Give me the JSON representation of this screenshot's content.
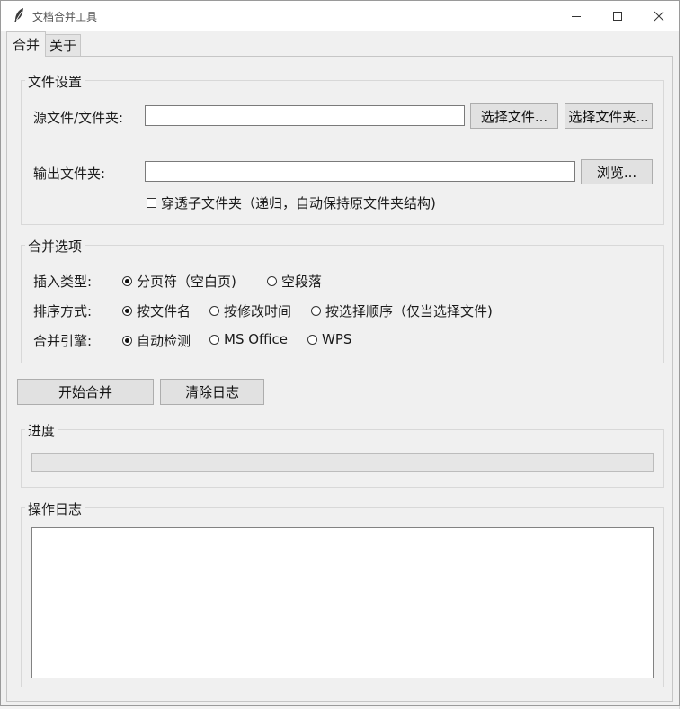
{
  "window": {
    "title": "文档合并工具",
    "controls": {
      "minimize": "minimize-icon",
      "maximize": "maximize-icon",
      "close": "close-icon"
    }
  },
  "tabs": [
    {
      "label": "合并",
      "active": true
    },
    {
      "label": "关于",
      "active": false
    }
  ],
  "file_settings": {
    "title": "文件设置",
    "source_label": "源文件/文件夹:",
    "source_value": "",
    "select_file_button": "选择文件...",
    "select_folder_button": "选择文件夹...",
    "output_label": "输出文件夹:",
    "output_value": "",
    "browse_button": "浏览...",
    "recursive_checkbox": "穿透子文件夹（递归，自动保持原文件夹结构)",
    "recursive_checked": false
  },
  "merge_options": {
    "title": "合并选项",
    "insert_type": {
      "label": "插入类型:",
      "options": [
        "分页符（空白页)",
        "空段落"
      ],
      "selected": 0
    },
    "sort_method": {
      "label": "排序方式:",
      "options": [
        "按文件名",
        "按修改时间",
        "按选择顺序（仅当选择文件)"
      ],
      "selected": 0
    },
    "engine": {
      "label": "合并引擎:",
      "options": [
        "自动检测",
        "MS Office",
        "WPS"
      ],
      "selected": 0
    }
  },
  "actions": {
    "start_button": "开始合并",
    "clear_log_button": "清除日志"
  },
  "progress": {
    "title": "进度",
    "value": 0
  },
  "log": {
    "title": "操作日志",
    "content": ""
  }
}
